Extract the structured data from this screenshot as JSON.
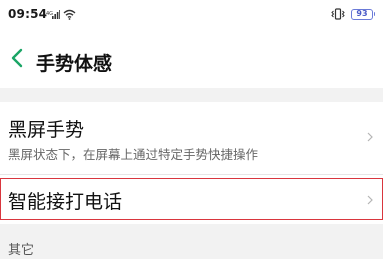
{
  "status_bar": {
    "time": "09:54",
    "battery_level": "93",
    "icons_left": [
      "signal-icon",
      "wifi-icon"
    ],
    "icons_right": [
      "vibrate-icon",
      "battery-icon"
    ],
    "battery_color": "#6a7ad8"
  },
  "header": {
    "title": "手势体感",
    "back_icon": "chevron-left-icon",
    "accent_color": "#1aa566"
  },
  "settings": {
    "items": [
      {
        "title": "黑屏手势",
        "subtitle": "黑屏状态下，在屏幕上通过特定手势快捷操作"
      },
      {
        "title": "智能接打电话",
        "highlight_color": "#d9363e"
      }
    ],
    "other_section_label": "其它"
  }
}
